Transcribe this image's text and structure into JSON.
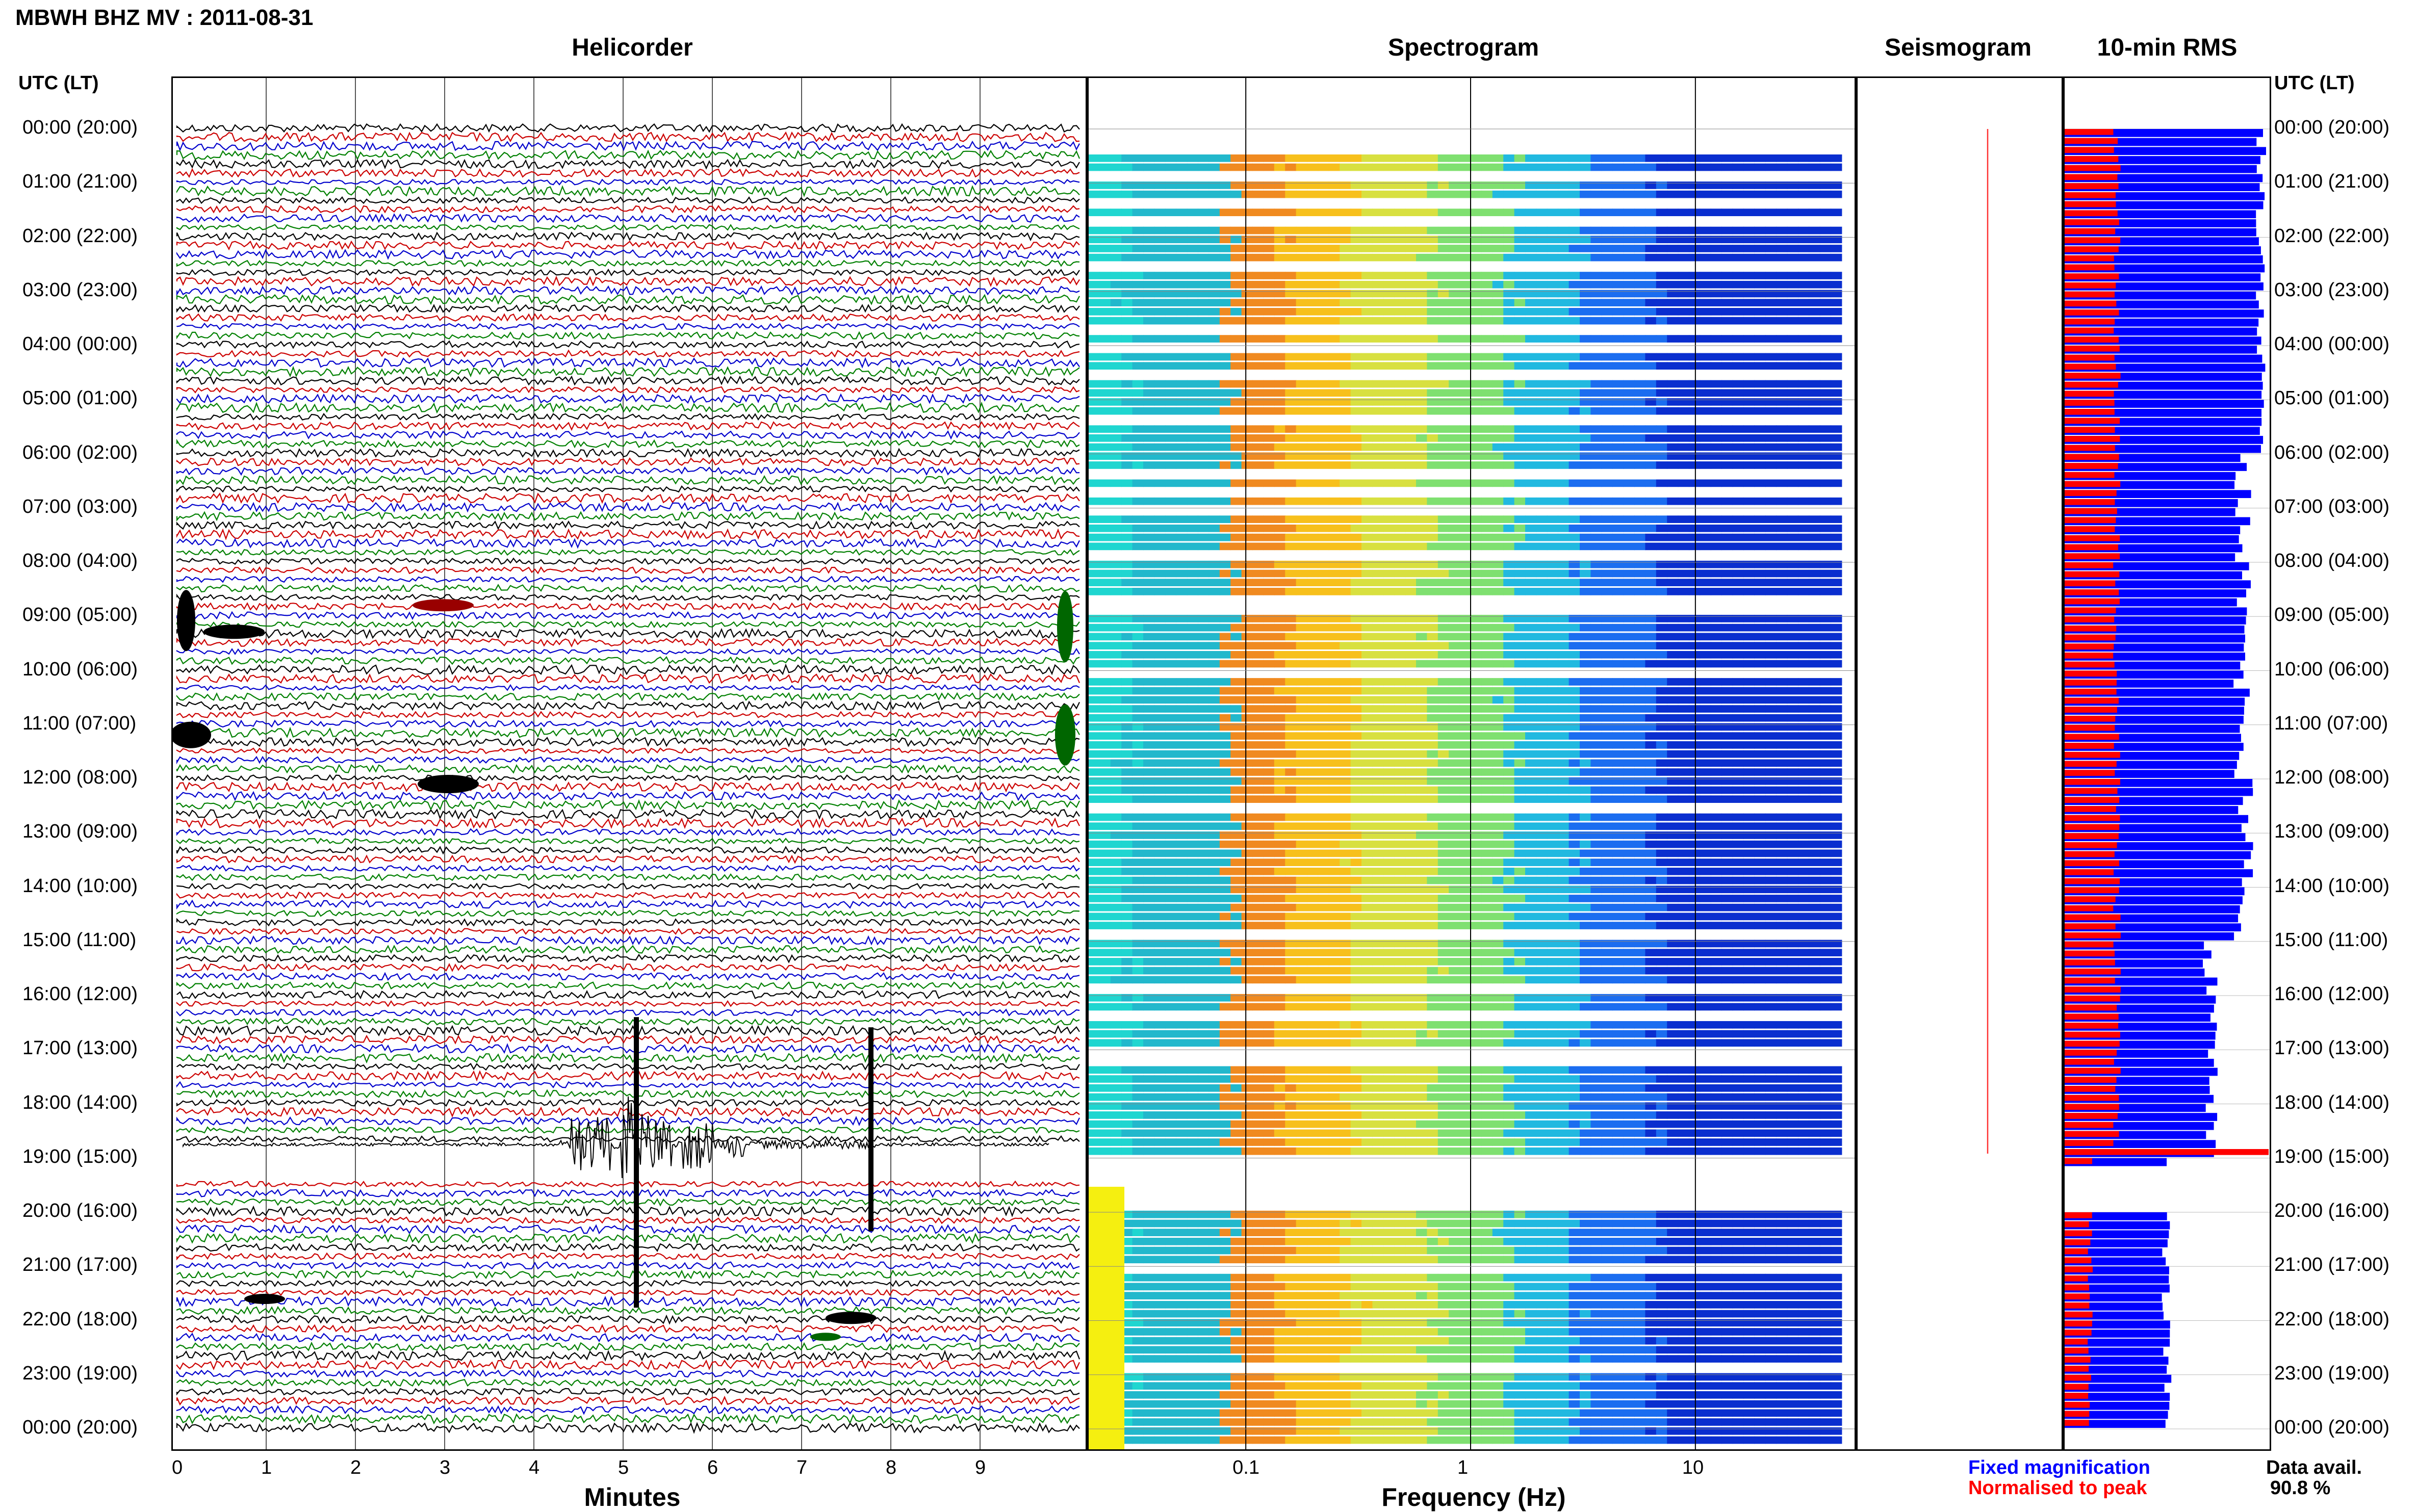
{
  "header": {
    "station_title": "MBWH BHZ MV : 2011-08-31"
  },
  "panels": {
    "helicorder": "Helicorder",
    "spectrogram": "Spectrogram",
    "seismogram": "Seismogram",
    "rms": "10-min RMS"
  },
  "axis": {
    "time_header_left": "UTC (LT)",
    "time_header_right": "UTC (LT)",
    "time_labels": [
      "00:00 (20:00)",
      "01:00 (21:00)",
      "02:00 (22:00)",
      "03:00 (23:00)",
      "04:00 (00:00)",
      "05:00 (01:00)",
      "06:00 (02:00)",
      "07:00 (03:00)",
      "08:00 (04:00)",
      "09:00 (05:00)",
      "10:00 (06:00)",
      "11:00 (07:00)",
      "12:00 (08:00)",
      "13:00 (09:00)",
      "14:00 (10:00)",
      "15:00 (11:00)",
      "16:00 (12:00)",
      "17:00 (13:00)",
      "18:00 (14:00)",
      "19:00 (15:00)",
      "20:00 (16:00)",
      "21:00 (17:00)",
      "22:00 (18:00)",
      "23:00 (19:00)",
      "00:00 (20:00)"
    ],
    "minutes_label": "Minutes",
    "minutes_ticks": [
      "0",
      "1",
      "2",
      "3",
      "4",
      "5",
      "6",
      "7",
      "8",
      "9"
    ],
    "frequency_label": "Frequency (Hz)",
    "frequency_ticks": [
      "0.1",
      "1",
      "10"
    ]
  },
  "legend": {
    "fixed": "Fixed magnification",
    "normalised": "Normalised to peak",
    "avail_label": "Data avail.",
    "avail_value": "90.8 %"
  },
  "colors": {
    "trace_cycle": [
      "#000000",
      "#cc0000",
      "#0000cc",
      "#008000"
    ],
    "rms_fixed": "#0000ff",
    "rms_normalised": "#ff0000",
    "legend_fixed": "#0000ff",
    "legend_normalised": "#ff0000"
  },
  "chart_data": [
    {
      "type": "line",
      "title": "Helicorder",
      "xlabel": "Minutes",
      "xlim": [
        0,
        10
      ],
      "rows_per_hour": 6,
      "data_gap_hours": [
        19.0,
        19.5
      ],
      "events": [
        {
          "hour": 9.0,
          "minute": 0.2,
          "amplitude": "large"
        },
        {
          "hour": 11.0,
          "minute": 0.1,
          "amplitude": "large"
        },
        {
          "hour": 12.0,
          "minute": 3.0,
          "amplitude": "medium"
        },
        {
          "hour": 18.6,
          "minute": 4.6,
          "amplitude": "very large"
        },
        {
          "hour": 18.6,
          "minute": 7.7,
          "amplitude": "very large"
        }
      ]
    },
    {
      "type": "heatmap",
      "title": "Spectrogram",
      "xlabel": "Frequency (Hz)",
      "xscale": "log",
      "xlim": [
        0.02,
        50
      ]
    },
    {
      "type": "bar",
      "title": "10-min RMS",
      "series": [
        {
          "name": "Fixed magnification"
        },
        {
          "name": "Normalised to peak"
        }
      ]
    }
  ]
}
